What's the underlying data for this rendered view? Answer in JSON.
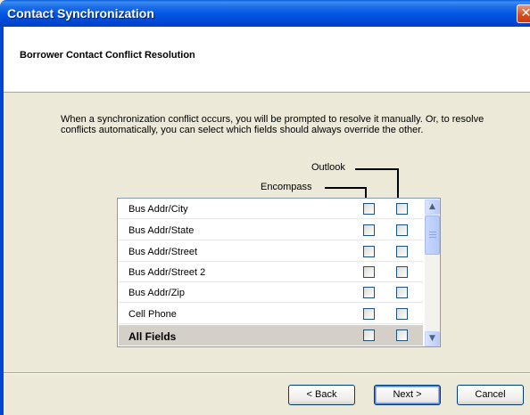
{
  "window": {
    "title": "Contact Synchronization",
    "close_glyph": "✕"
  },
  "header": {
    "title": "Borrower Contact Conflict Resolution"
  },
  "description": "When a synchronization conflict occurs, you will be prompted to resolve it manually. Or, to resolve conflicts automatically, you can select which fields should always override the other.",
  "columns": {
    "outlook": "Outlook",
    "encompass": "Encompass"
  },
  "fields": [
    {
      "label": "Bus Addr/City",
      "encompass": false,
      "outlook": false
    },
    {
      "label": "Bus Addr/State",
      "encompass": false,
      "outlook": false
    },
    {
      "label": "Bus Addr/Street",
      "encompass": false,
      "outlook": false
    },
    {
      "label": "Bus Addr/Street 2",
      "encompass": false,
      "outlook": false
    },
    {
      "label": "Bus Addr/Zip",
      "encompass": false,
      "outlook": false
    },
    {
      "label": "Cell Phone",
      "encompass": false,
      "outlook": false
    }
  ],
  "all_fields": {
    "label": "All Fields",
    "encompass": false,
    "outlook": false
  },
  "buttons": {
    "back": "< Back",
    "next": "Next >",
    "cancel": "Cancel"
  },
  "colors": {
    "title_bar": "#0054e3",
    "dialog_bg": "#ece9d8",
    "close": "#d9481c"
  }
}
